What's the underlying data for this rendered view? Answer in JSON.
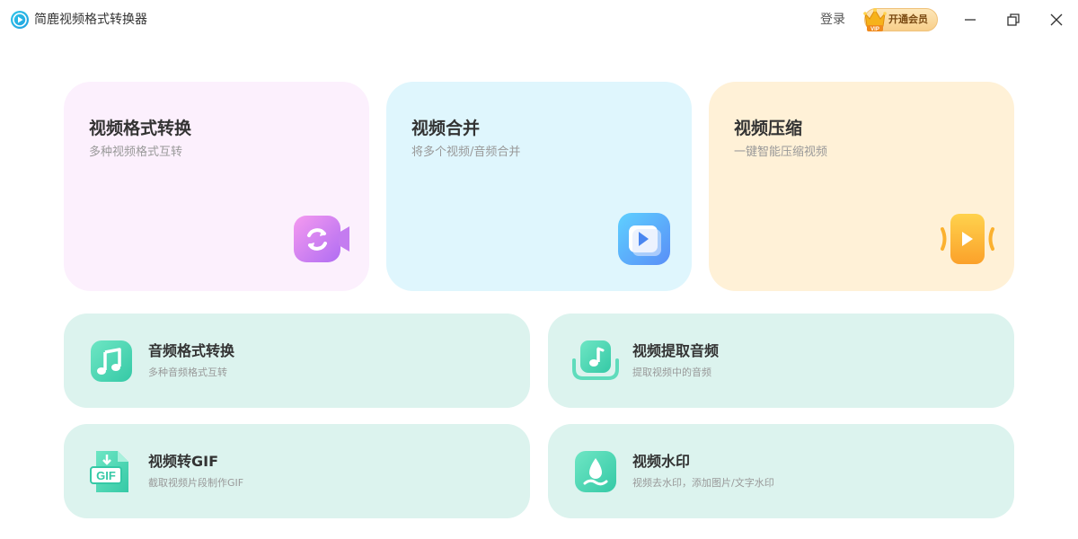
{
  "titlebar": {
    "app_title": "简鹿视频格式转换器",
    "login_label": "登录",
    "vip_label": "开通会员",
    "vip_badge": "VIP"
  },
  "colors": {
    "accent_teal": "#3fcfae",
    "card_pink": "#fcf0fd",
    "card_blue": "#dff6fd",
    "card_yellow": "#fff1d7",
    "card_mint": "#dcf3ee"
  },
  "big_cards": [
    {
      "title": "视频格式转换",
      "subtitle": "多种视频格式互转",
      "icon": "video-convert-icon"
    },
    {
      "title": "视频合并",
      "subtitle": "将多个视频/音频合并",
      "icon": "video-merge-icon"
    },
    {
      "title": "视频压缩",
      "subtitle": "一键智能压缩视频",
      "icon": "video-compress-icon"
    }
  ],
  "small_cards": [
    {
      "title": "音频格式转换",
      "subtitle": "多种音频格式互转",
      "icon": "music-note-icon"
    },
    {
      "title": "视频提取音频",
      "subtitle": "提取视频中的音频",
      "icon": "audio-extract-icon"
    },
    {
      "title": "视频转GIF",
      "subtitle": "截取视频片段制作GIF",
      "icon": "gif-file-icon",
      "icon_text": "GIF"
    },
    {
      "title": "视频水印",
      "subtitle": "视频去水印，添加图片/文字水印",
      "icon": "watermark-drop-icon"
    }
  ]
}
